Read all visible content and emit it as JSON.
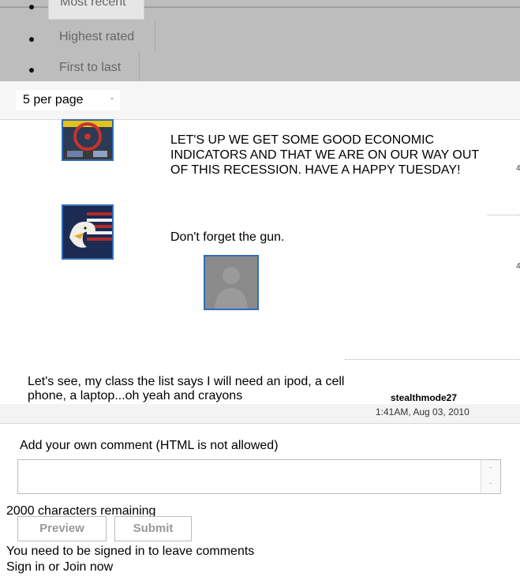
{
  "sort": {
    "items": [
      "Most recent",
      "Highest rated",
      "First to last"
    ]
  },
  "perpage": {
    "value": "5 per page",
    "arrow": "-"
  },
  "comments": [
    {
      "text": "LET'S UP WE GET SOME GOOD ECONOMIC INDICATORS AND THAT WE ARE ON OUR WAY OUT OF THIS RECESSION.  HAVE A HAPPY TUESDAY!"
    },
    {
      "text": "Don't forget the gun."
    },
    {
      "text": "Let's see, my class the list says I will need an ipod, a cell phone, a laptop...oh yeah and crayons",
      "author": "stealthmode27",
      "time": "1:41AM, Aug 03, 2010"
    }
  ],
  "edge_marks": [
    "4",
    "4"
  ],
  "compose": {
    "heading": "Add your own comment (HTML is not allowed)",
    "remaining": "2000 characters remaining",
    "preview_label": "Preview",
    "submit_label": "Submit",
    "signin_notice": "You need to be signed in to leave comments",
    "signin_link": "Sign in or Join now",
    "scroll_up": "-",
    "scroll_down": "-"
  }
}
